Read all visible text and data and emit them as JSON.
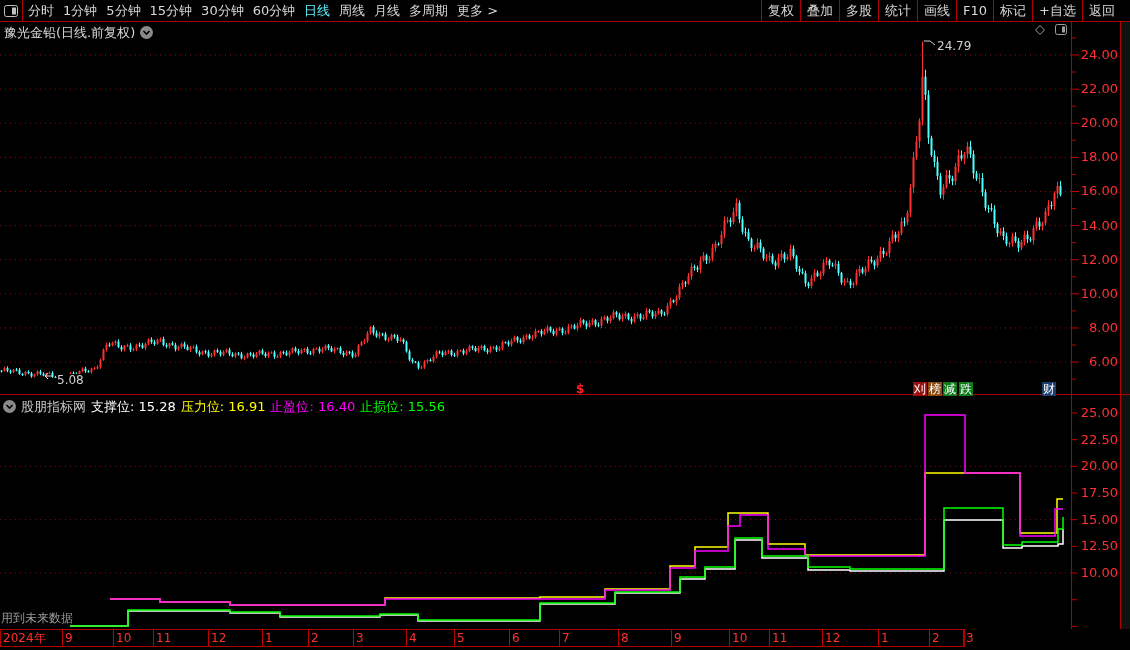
{
  "toolbar": {
    "periods": [
      {
        "label": "分时",
        "selected": false
      },
      {
        "label": "1分钟",
        "selected": false
      },
      {
        "label": "5分钟",
        "selected": false
      },
      {
        "label": "15分钟",
        "selected": false
      },
      {
        "label": "30分钟",
        "selected": false
      },
      {
        "label": "60分钟",
        "selected": false
      },
      {
        "label": "日线",
        "selected": true
      },
      {
        "label": "周线",
        "selected": false
      },
      {
        "label": "月线",
        "selected": false
      },
      {
        "label": "多周期",
        "selected": false
      },
      {
        "label": "更多 >",
        "selected": false
      }
    ],
    "buttons": [
      "复权",
      "叠加",
      "多股",
      "统计",
      "画线",
      "F10",
      "标记",
      "+自选",
      "返回"
    ]
  },
  "chart": {
    "title": "豫光金铅(日线.前复权)",
    "high_label": "24.79",
    "low_label": "5.08",
    "price_axis": [
      "24.00",
      "22.00",
      "20.00",
      "18.00",
      "16.00",
      "14.00",
      "12.00",
      "10.00",
      "8.00",
      "6.00"
    ],
    "events": [
      {
        "kind": "marker",
        "text": "$",
        "color": "#ff2020"
      },
      {
        "kind": "badge",
        "text": "刈",
        "color": "#9b1010"
      },
      {
        "kind": "badge",
        "text": "榜",
        "color": "#8a4a10"
      },
      {
        "kind": "badge",
        "text": "减",
        "color": "#0f7a1a"
      },
      {
        "kind": "badge",
        "text": "跌",
        "color": "#0f7a1a"
      },
      {
        "kind": "badge",
        "text": "财",
        "color": "#1b3f6e"
      }
    ]
  },
  "indicator": {
    "name": "股朋指标网",
    "values": [
      {
        "text": "支撑位: 15.28",
        "color": "#ffffff"
      },
      {
        "text": "压力位: 16.91",
        "color": "#ffff00"
      },
      {
        "text": "止盈位: 16.40",
        "color": "#ff00ff"
      },
      {
        "text": "止损位: 15.56",
        "color": "#00ff00"
      }
    ],
    "axis": [
      "25.00",
      "22.50",
      "20.00",
      "17.50",
      "15.00",
      "12.50",
      "10.00"
    ],
    "note": "用到未来数据"
  },
  "time_axis": [
    "2024年",
    "9",
    "10",
    "11",
    "12",
    "1",
    "2",
    "3",
    "4",
    "5",
    "6",
    "7",
    "8",
    "9",
    "10",
    "11",
    "12",
    "1",
    "2",
    "3"
  ]
}
